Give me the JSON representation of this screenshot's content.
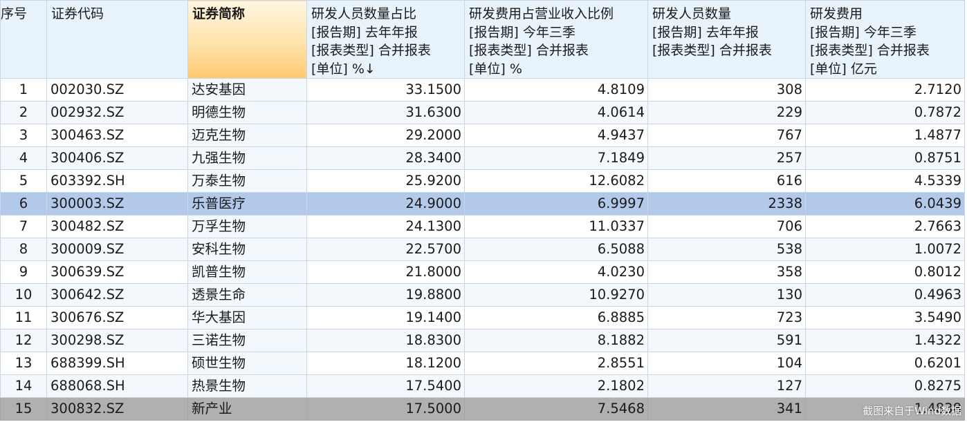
{
  "columns": [
    {
      "lines": [
        "序号"
      ]
    },
    {
      "lines": [
        "证券代码"
      ]
    },
    {
      "lines": [
        "证券简称"
      ]
    },
    {
      "lines": [
        "研发人员数量占比",
        "[报告期] 去年年报",
        "[报表类型] 合并报表",
        "[单位] %↓"
      ]
    },
    {
      "lines": [
        "研发费用占营业收入比例",
        "[报告期] 今年三季",
        "[报表类型] 合并报表",
        "[单位] %"
      ]
    },
    {
      "lines": [
        "研发人员数量",
        "[报告期] 去年年报",
        "[报表类型] 合并报表"
      ]
    },
    {
      "lines": [
        "研发费用",
        "[报告期] 今年三季",
        "[报表类型] 合并报表",
        "[单位] 亿元"
      ]
    }
  ],
  "rows": [
    [
      "1",
      "002030.SZ",
      "达安基因",
      "33.1500",
      "4.8109",
      "308",
      "2.7120"
    ],
    [
      "2",
      "002932.SZ",
      "明德生物",
      "31.6300",
      "4.0614",
      "229",
      "0.7872"
    ],
    [
      "3",
      "300463.SZ",
      "迈克生物",
      "29.2000",
      "4.9437",
      "767",
      "1.4877"
    ],
    [
      "4",
      "300406.SZ",
      "九强生物",
      "28.3400",
      "7.1849",
      "257",
      "0.8751"
    ],
    [
      "5",
      "603392.SH",
      "万泰生物",
      "25.9200",
      "12.6082",
      "616",
      "4.5339"
    ],
    [
      "6",
      "300003.SZ",
      "乐普医疗",
      "24.9000",
      "6.9997",
      "2338",
      "6.0439"
    ],
    [
      "7",
      "300482.SZ",
      "万孚生物",
      "24.1300",
      "11.0337",
      "706",
      "2.7663"
    ],
    [
      "8",
      "300009.SZ",
      "安科生物",
      "22.5700",
      "6.5088",
      "538",
      "1.0072"
    ],
    [
      "9",
      "300639.SZ",
      "凯普生物",
      "21.8000",
      "4.0230",
      "358",
      "0.8012"
    ],
    [
      "10",
      "300642.SZ",
      "透景生命",
      "19.8800",
      "10.9270",
      "130",
      "0.4963"
    ],
    [
      "11",
      "300676.SZ",
      "华大基因",
      "19.1400",
      "6.8885",
      "723",
      "3.5490"
    ],
    [
      "12",
      "300298.SZ",
      "三诺生物",
      "18.8300",
      "8.1882",
      "591",
      "1.4322"
    ],
    [
      "13",
      "688399.SH",
      "硕世生物",
      "18.1200",
      "2.8551",
      "104",
      "0.6201"
    ],
    [
      "14",
      "688068.SH",
      "热景生物",
      "17.5400",
      "2.1802",
      "127",
      "0.8275"
    ],
    [
      "15",
      "300832.SZ",
      "新产业",
      "17.5000",
      "7.5468",
      "341",
      "1.4838"
    ]
  ],
  "selected_row": "6",
  "sorted_column": "证券简称",
  "watermark": "截图来自于Wind数据",
  "colors": {
    "header_bg": "#e9f3fc",
    "sorted_header": "#ffc970",
    "selected_row": "#b3c9ea",
    "last_row": "#b0b0b0"
  }
}
